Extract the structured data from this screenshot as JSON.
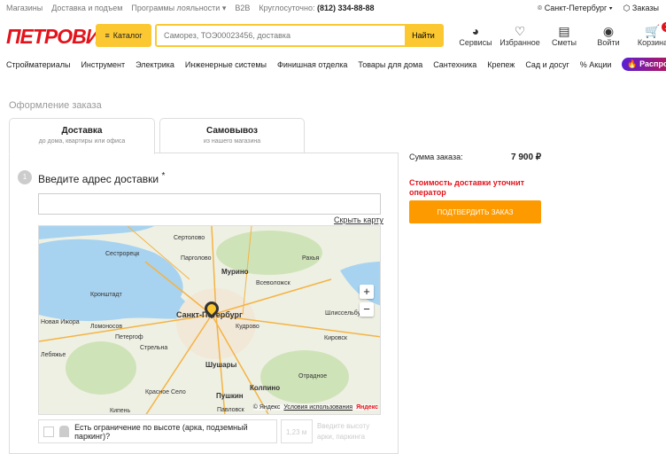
{
  "topbar": {
    "links": [
      "Магазины",
      "Доставка и подъем",
      "Программы лояльности ▾",
      "B2B"
    ],
    "phone_label": "Круглосуточно:",
    "phone": "(812) 334-88-88",
    "city": "Санкт-Петербург ▾",
    "orders": "Заказы"
  },
  "header": {
    "logo": "ПЕТРОВИЧ",
    "catalog": "Каталог",
    "search_placeholder": "Саморез, ТОЭ00023456, доставка",
    "search_button": "Найти",
    "icons": [
      {
        "label": "Сервисы",
        "glyph": "◕"
      },
      {
        "label": "Избранное",
        "glyph": "♡"
      },
      {
        "label": "Сметы",
        "glyph": "▤"
      },
      {
        "label": "Войти",
        "glyph": "◉"
      },
      {
        "label": "Корзина",
        "glyph": "🛒"
      }
    ],
    "cart_count": "1"
  },
  "nav": {
    "items": [
      "Стройматериалы",
      "Инструмент",
      "Электрика",
      "Инженерные системы",
      "Финишная отделка",
      "Товары для дома",
      "Сантехника",
      "Крепеж",
      "Сад и досуг",
      "% Акции"
    ],
    "sale": "🔥 Распродажа"
  },
  "order": {
    "title": "Оформление заказа",
    "tabs": [
      {
        "label": "Доставка",
        "sub": "до дома, квартиры или офиса"
      },
      {
        "label": "Самовывоз",
        "sub": "из нашего магазина"
      }
    ],
    "step_number": "1",
    "step_title": "Введите адрес доставки",
    "required": "*",
    "hide_map": "Скрыть карту",
    "map_labels": [
      "Сестрорецк",
      "Сертолово",
      "Парголово",
      "Мурино",
      "Всеволожск",
      "Рахья",
      "Кронштадт",
      "Санкт-Петербург",
      "Кудрово",
      "Шлиссельбург",
      "Новая Ижора",
      "Ломоносов",
      "Петергоф",
      "Стрельна",
      "Кировск",
      "Шушары",
      "Красное Село",
      "Пушкин",
      "Колпино",
      "Отрадное",
      "Кипень",
      "Павловск",
      "Лебяжье"
    ],
    "map_copyright": "© Яндекс",
    "map_terms": "Условия использования",
    "map_brand": "Яндекс",
    "height_question": "Есть ограничение по высоте (арка, подземный паркинг)?",
    "height_placeholder": "1,23 м",
    "height_hint": "Введите высоту арки, паркинга"
  },
  "summary": {
    "label": "Сумма заказа:",
    "value": "7 900 ₽",
    "warning": "Стоимость доставки уточнит оператор",
    "confirm": "ПОДТВЕРДИТЬ ЗАКАЗ"
  }
}
